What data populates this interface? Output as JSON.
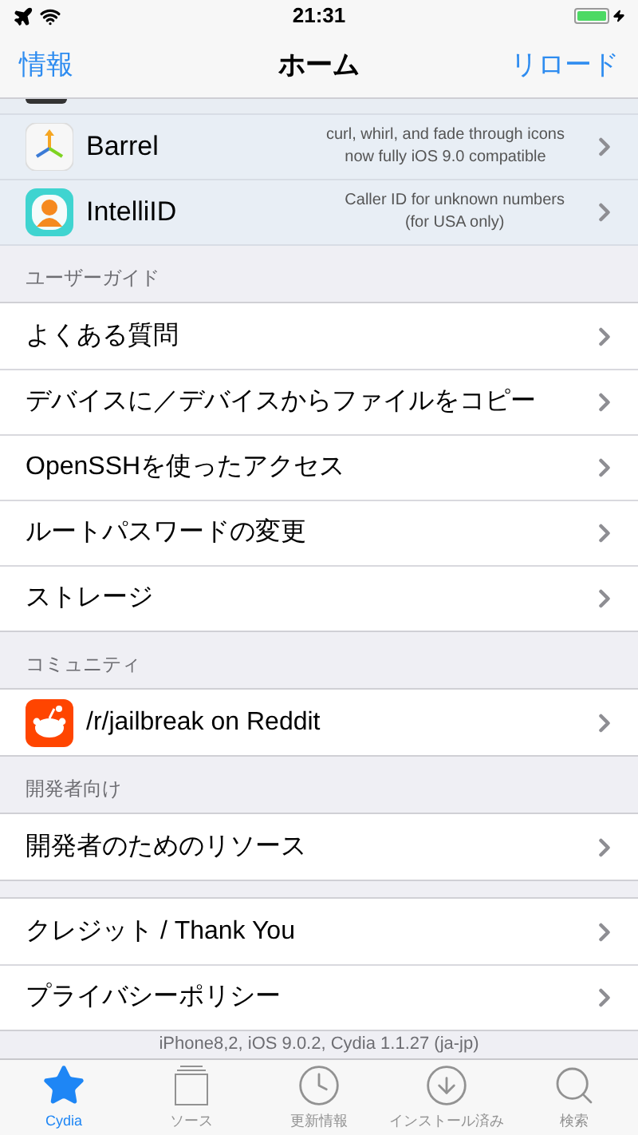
{
  "status_bar": {
    "time": "21:31"
  },
  "nav": {
    "left": "情報",
    "title": "ホーム",
    "right": "リロード"
  },
  "featured": [
    {
      "kind": "arrows",
      "name": "Barrel",
      "subtitle": [
        "curl, whirl, and fade through icons",
        "now fully iOS 9.0 compatible"
      ]
    },
    {
      "kind": "person",
      "name": "IntelliID",
      "subtitle": [
        "Caller ID for unknown numbers",
        "(for USA only)"
      ]
    }
  ],
  "sections": [
    {
      "header": "ユーザーガイド",
      "rows": [
        {
          "kind": "text",
          "label": "よくある質問"
        },
        {
          "kind": "text",
          "label": "デバイスに／デバイスからファイルをコピー"
        },
        {
          "kind": "text",
          "label": "OpenSSHを使ったアクセス"
        },
        {
          "kind": "text",
          "label": "ルートパスワードの変更"
        },
        {
          "kind": "text",
          "label": "ストレージ"
        }
      ]
    },
    {
      "header": "コミュニティ",
      "rows": [
        {
          "kind": "alien",
          "label": "/r/jailbreak on Reddit"
        }
      ]
    },
    {
      "header": "開発者向け",
      "rows": [
        {
          "kind": "text",
          "label": "開発者のためのリソース"
        }
      ]
    },
    {
      "rows": [
        {
          "kind": "text",
          "label": "クレジット / Thank You"
        },
        {
          "kind": "text",
          "label": "プライバシーポリシー"
        }
      ]
    }
  ],
  "footer": "iPhone8,2, iOS 9.0.2, Cydia 1.1.27 (ja-jp)",
  "tabs": [
    {
      "kind": "star",
      "label": "Cydia",
      "selected": true
    },
    {
      "kind": "stack",
      "label": "ソース",
      "selected": false
    },
    {
      "kind": "clock",
      "label": "更新情報",
      "selected": false
    },
    {
      "kind": "download",
      "label": "インストール済み",
      "selected": false
    },
    {
      "kind": "search",
      "label": "検索",
      "selected": false
    }
  ]
}
